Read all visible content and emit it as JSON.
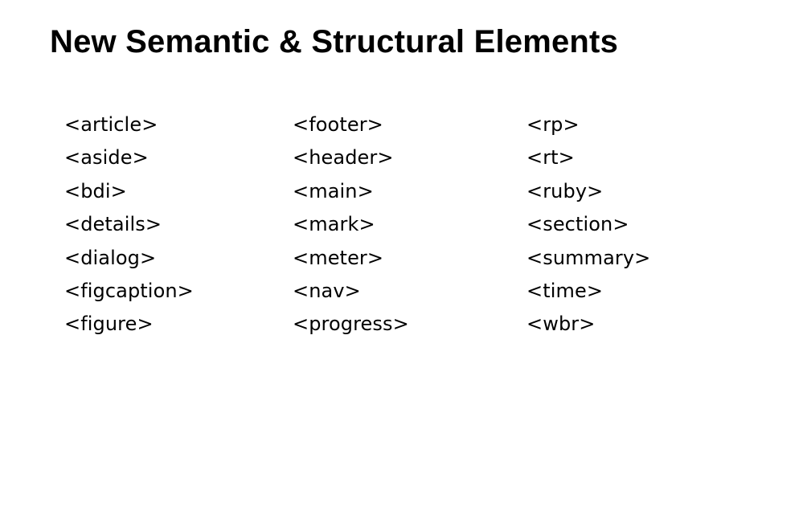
{
  "slide": {
    "title": "New Semantic & Structural Elements",
    "columns": [
      {
        "items": [
          "<article>",
          "<aside>",
          "<bdi>",
          "<details>",
          "<dialog>",
          "<figcaption>",
          "<figure>"
        ]
      },
      {
        "items": [
          "<footer>",
          "<header>",
          "<main>",
          "<mark>",
          "<meter>",
          "<nav>",
          "<progress>"
        ]
      },
      {
        "items": [
          "<rp>",
          "<rt>",
          "<ruby>",
          "<section>",
          "<summary>",
          "<time>",
          "<wbr>"
        ]
      }
    ]
  }
}
